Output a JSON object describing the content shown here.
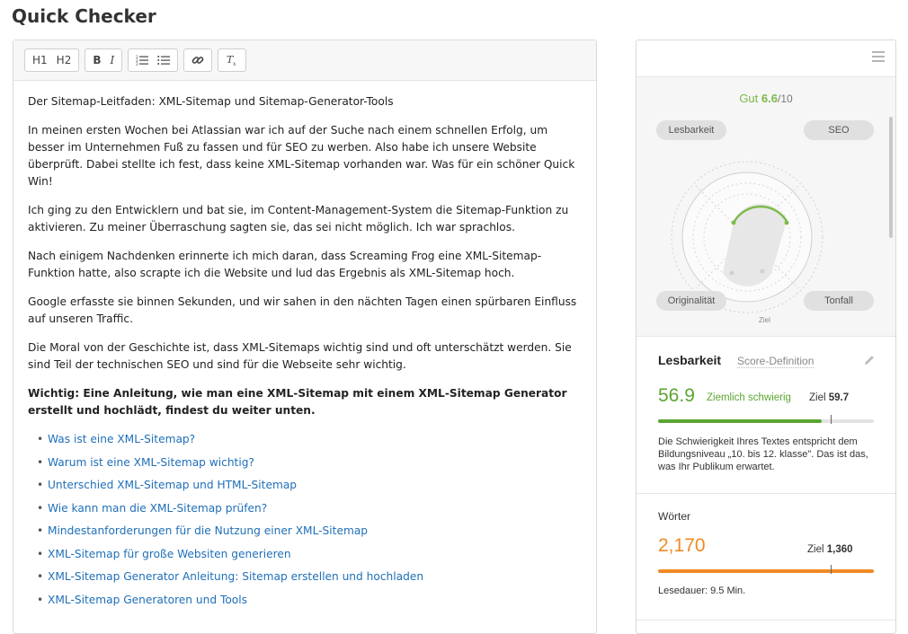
{
  "page": {
    "title": "Quick Checker"
  },
  "toolbar": {
    "h1": "H1",
    "h2": "H2",
    "bold": "B",
    "italic": "I"
  },
  "editor": {
    "heading_line": "Der Sitemap-Leitfaden: XML-Sitemap und Sitemap-Generator-Tools",
    "paragraphs": [
      "In meinen ersten Wochen bei Atlassian war ich auf der Suche nach einem schnellen Erfolg, um besser im Unternehmen Fuß zu fassen und für SEO zu werben. Also habe ich unsere Website überprüft. Dabei stellte ich fest, dass keine XML-Sitemap vorhanden war. Was für ein schöner Quick Win!",
      "Ich ging zu den Entwicklern und bat sie, im Content-Management-System die Sitemap-Funktion zu aktivieren. Zu meiner Überraschung sagten sie, das sei nicht möglich. Ich war sprachlos.",
      "Nach einigem Nachdenken erinnerte ich mich daran, dass Screaming Frog eine XML-Sitemap-Funktion hatte, also scrapte ich die Website und lud das Ergebnis als XML-Sitemap hoch.",
      "Google erfasste sie binnen Sekunden, und wir sahen in den nächten Tagen einen spürbaren Einfluss auf unseren Traffic.",
      "Die Moral von der Geschichte ist, dass XML-Sitemaps wichtig sind und oft unterschätzt werden. Sie sind Teil der technischen SEO und sind für die Webseite sehr wichtig."
    ],
    "bold_note": "Wichtig: Eine Anleitung, wie man eine XML-Sitemap mit einem XML-Sitemap Generator erstellt und hochlädt, findest du weiter unten.",
    "links": [
      "Was ist eine XML-Sitemap?",
      "Warum ist eine XML-Sitemap wichtig?",
      "Unterschied XML-Sitemap und HTML-Sitemap",
      "Wie kann man die XML-Sitemap prüfen?",
      "Mindestanforderungen für die Nutzung einer XML-Sitemap",
      "XML-Sitemap für große Websiten generieren",
      "XML-Sitemap Generator Anleitung: Sitemap erstellen und hochladen",
      "XML-Sitemap Generatoren und Tools"
    ]
  },
  "score": {
    "label": "Gut",
    "value": "6.6",
    "denominator": "/10",
    "pills": [
      "Lesbarkeit",
      "SEO",
      "Originalität",
      "Tonfall"
    ],
    "target_label": "Ziel",
    "color": "#7bb94a"
  },
  "readability": {
    "title": "Lesbarkeit",
    "link": "Score-Definition",
    "value": "56.9",
    "rating": "Ziemlich schwierig",
    "target_prefix": "Ziel",
    "target": "59.7",
    "progress": 0.76,
    "target_fraction": 0.8,
    "color": "#5aa531",
    "explanation": "Die Schwierigkeit Ihres Textes entspricht dem Bildungsniveau „10. bis 12. klasse\". Das ist das, was Ihr Publikum erwartet."
  },
  "words": {
    "title": "Wörter",
    "value": "2,170",
    "target_prefix": "Ziel",
    "target": "1,360",
    "progress": 1.0,
    "target_fraction": 0.8,
    "color": "#f08a24",
    "reading_time": "Lesedauer: 9.5 Min."
  }
}
